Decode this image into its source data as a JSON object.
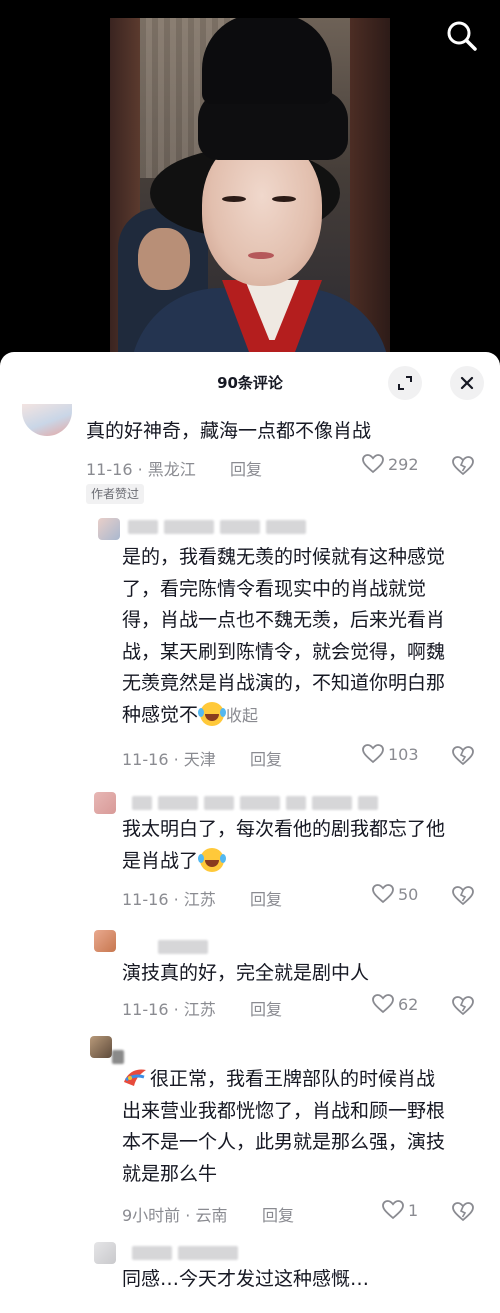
{
  "header": {
    "title": "90条评论"
  },
  "colors": {
    "text": "#161823",
    "meta": "#8a8b91",
    "background": "#ffffff"
  },
  "icons": [
    "search-icon",
    "expand-icon",
    "close-icon",
    "heart-icon",
    "dislike-icon",
    "laugh-cry-emoji"
  ],
  "comments": [
    {
      "text": "真的好神奇，藏海一点都不像肖战",
      "date": "11-16 · 黑龙江",
      "reply_label": "回复",
      "likes": "292",
      "badge": "作者赞过"
    },
    {
      "text_lines": [
        "是的，我看魏无羡的时候就有这种感觉",
        "了，看完陈情令看现实中的肖战就觉",
        "得，肖战一点也不魏无羡，后来光看肖",
        "战，某天刷到陈情令，就会觉得，啊魏",
        "无羡竟然是肖战演的，不知道你明白那",
        "种感觉不"
      ],
      "collapse_label": "收起",
      "date": "11-16 · 天津",
      "reply_label": "回复",
      "likes": "103"
    },
    {
      "text_lines": [
        "我太明白了，每次看他的剧我都忘了他",
        "是肖战了"
      ],
      "date": "11-16 · 江苏",
      "reply_label": "回复",
      "likes": "50"
    },
    {
      "text": "演技真的好，完全就是剧中人",
      "date": "11-16 · 江苏",
      "reply_label": "回复",
      "likes": "62"
    },
    {
      "text_lines": [
        "很正常，我看王牌部队的时候肖战",
        "出来营业我都恍惚了，肖战和顾一野根",
        "本不是一个人，此男就是那么强，演技",
        "就是那么牛"
      ],
      "date": "9小时前 · 云南",
      "reply_label": "回复",
      "likes": "1"
    },
    {
      "text": "同感…今天才发过这种感慨…"
    }
  ]
}
